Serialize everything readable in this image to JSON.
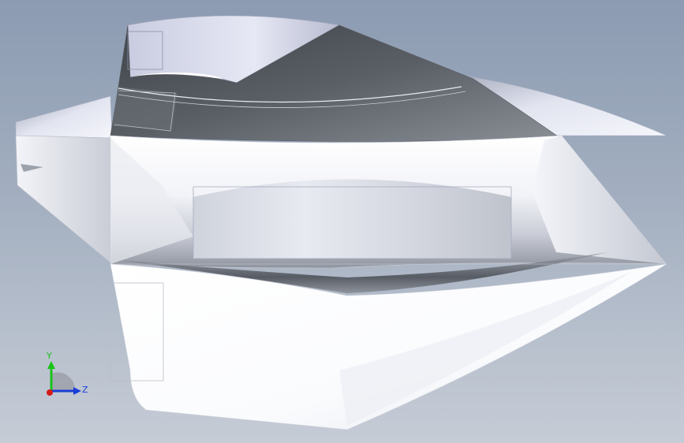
{
  "triad": {
    "y_label": "Y",
    "z_label": "Z",
    "colors": {
      "y_axis": "#19c219",
      "z_axis": "#1a3fd6",
      "x_axis": "#d61a1a"
    }
  },
  "colors": {
    "background_top": "#8c9bb2",
    "background_bottom": "#c6ccd6",
    "shade_dark": "#4f5459",
    "shade_light": "#ffffff"
  }
}
